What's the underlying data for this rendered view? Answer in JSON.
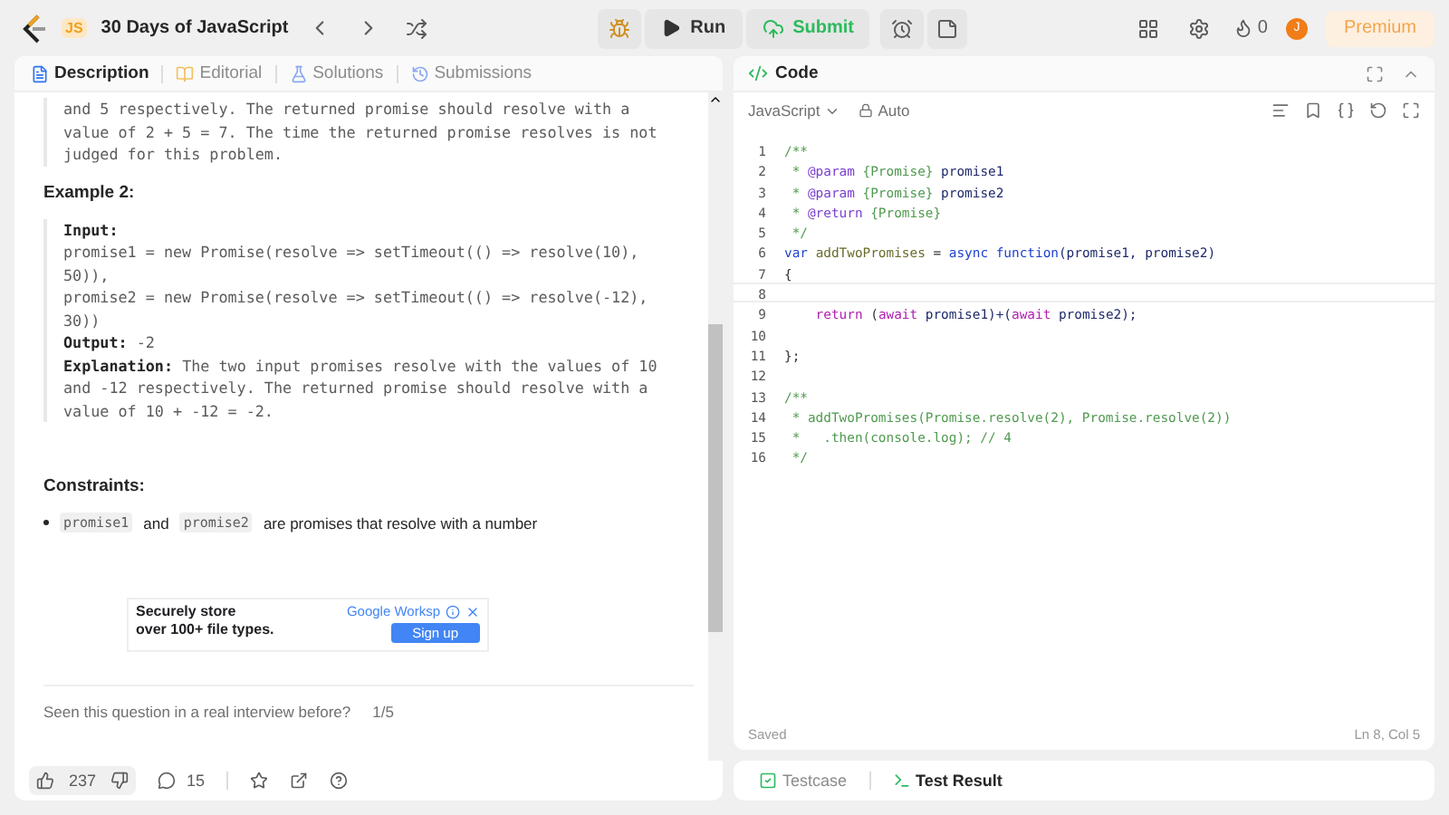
{
  "topbar": {
    "title": "30 Days of JavaScript",
    "logo_badge": "JS",
    "run": "Run",
    "submit": "Submit",
    "streak": "0",
    "avatar": "J",
    "premium": "Premium"
  },
  "left_tabs": [
    {
      "label": "Description",
      "selected": true
    },
    {
      "label": "Editorial",
      "selected": false
    },
    {
      "label": "Solutions",
      "selected": false
    },
    {
      "label": "Submissions",
      "selected": false
    }
  ],
  "example1_tail": [
    "and 5 respectively. The returned promise should resolve with a",
    "value of 2 + 5 = 7. The time the returned promise resolves is not",
    "judged for this problem."
  ],
  "example2": {
    "heading": "Example 2:",
    "input_label": "Input:",
    "input_lines": [
      "promise1 = new Promise(resolve => setTimeout(() => resolve(10),",
      "50)),",
      "promise2 = new Promise(resolve => setTimeout(() => resolve(-12),",
      "30))"
    ],
    "output_label": "Output:",
    "output_value": "-2",
    "explanation_label": "Explanation:",
    "explanation_lines": [
      "The two input promises resolve with the values of 10",
      "and -12 respectively. The returned promise should resolve with a",
      "value of 10 + -12 = -2."
    ]
  },
  "constraints": {
    "heading": "Constraints:",
    "item": {
      "code1": "promise1",
      "middle": "and",
      "code2": "promise2",
      "rest": "are promises that resolve with a number"
    }
  },
  "ad": {
    "line1": "Securely",
    "line1b": "store",
    "line2": "over 100+ file types.",
    "brand": "Google Worksp",
    "button": "Sign up"
  },
  "interview": {
    "question": "Seen this question in a real interview before?",
    "count": "1/5"
  },
  "footer": {
    "likes": "237",
    "comments": "15"
  },
  "code_header": {
    "title": "Code",
    "language": "JavaScript",
    "mode": "Auto"
  },
  "code_lines": [
    {
      "number": "1",
      "current": false,
      "tokens": [
        {
          "t": "/**",
          "kind": "comment"
        }
      ]
    },
    {
      "number": "2",
      "current": false,
      "tokens": [
        {
          "t": " * ",
          "kind": "comment"
        },
        {
          "t": "@param",
          "kind": "tag"
        },
        {
          "t": " {Promise}",
          "kind": "type"
        },
        {
          "t": " promise1",
          "kind": "name"
        }
      ]
    },
    {
      "number": "3",
      "current": false,
      "tokens": [
        {
          "t": " * ",
          "kind": "comment"
        },
        {
          "t": "@param",
          "kind": "tag"
        },
        {
          "t": " {Promise}",
          "kind": "type"
        },
        {
          "t": " promise2",
          "kind": "name"
        }
      ]
    },
    {
      "number": "4",
      "current": false,
      "tokens": [
        {
          "t": " * ",
          "kind": "comment"
        },
        {
          "t": "@return",
          "kind": "tag"
        },
        {
          "t": " {Promise}",
          "kind": "type"
        }
      ]
    },
    {
      "number": "5",
      "current": false,
      "tokens": [
        {
          "t": " */",
          "kind": "comment"
        }
      ]
    },
    {
      "number": "6",
      "current": false,
      "tokens": [
        {
          "t": "var ",
          "kind": "keyword"
        },
        {
          "t": "addTwoPromises",
          "kind": "def"
        },
        {
          "t": " = ",
          "kind": "plain"
        },
        {
          "t": "async function",
          "kind": "keyword"
        },
        {
          "t": "(promise1, promise2)",
          "kind": "name"
        }
      ]
    },
    {
      "number": "7",
      "current": false,
      "tokens": [
        {
          "t": "{",
          "kind": "plain"
        }
      ]
    },
    {
      "number": "8",
      "current": true
    },
    {
      "number": "9",
      "current": false,
      "tokens": [
        {
          "t": "    return",
          "kind": "control"
        },
        {
          "t": " (",
          "kind": "plain"
        },
        {
          "t": "await",
          "kind": "control"
        },
        {
          "t": " promise1)+(",
          "kind": "name"
        },
        {
          "t": "await",
          "kind": "control"
        },
        {
          "t": " promise2);",
          "kind": "name"
        }
      ]
    },
    {
      "number": "10",
      "current": false
    },
    {
      "number": "11",
      "current": false,
      "tokens": [
        {
          "t": "};",
          "kind": "plain"
        }
      ]
    },
    {
      "number": "12",
      "current": false
    },
    {
      "number": "13",
      "current": false,
      "tokens": [
        {
          "t": "/**",
          "kind": "comment"
        }
      ]
    },
    {
      "number": "14",
      "current": false,
      "tokens": [
        {
          "t": " * addTwoPromises(Promise.resolve(2), Promise.resolve(2))",
          "kind": "comment"
        }
      ]
    },
    {
      "number": "15",
      "current": false,
      "tokens": [
        {
          "t": " *   .then(console.log); // 4",
          "kind": "comment"
        }
      ]
    },
    {
      "number": "16",
      "current": false,
      "tokens": [
        {
          "t": " */",
          "kind": "comment"
        }
      ]
    }
  ],
  "status": {
    "saved": "Saved",
    "position": "Ln 8, Col 5"
  },
  "bottom_tabs": [
    {
      "label": "Testcase",
      "selected": false
    },
    {
      "label": "Test Result",
      "selected": true
    }
  ]
}
